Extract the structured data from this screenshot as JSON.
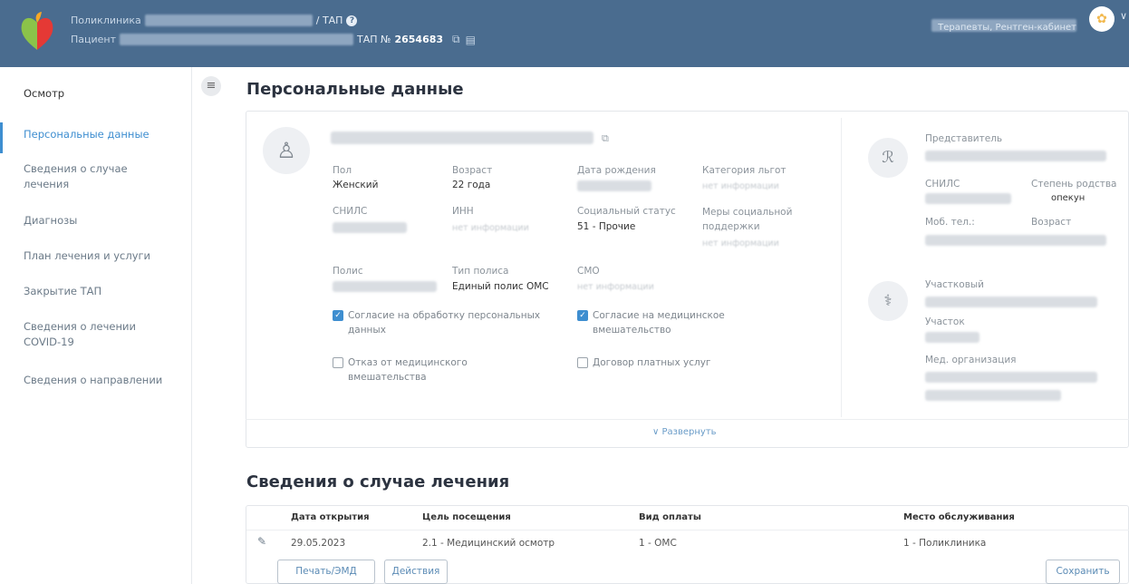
{
  "header": {
    "polyclinic_label": "Поликлиника",
    "patient_label": "Пациент",
    "tal_label": "ТАП",
    "tal_number_label": "ТАП №",
    "tal_number": "2654683",
    "help_icon": "?",
    "role_text": "Терапевты, Рентген-кабинет"
  },
  "sidebar": {
    "items": [
      {
        "label": "Осмотр"
      },
      {
        "label": "Персональные данные"
      },
      {
        "label": "Сведения о случае лечения"
      },
      {
        "label": "Диагнозы"
      },
      {
        "label": "План лечения и услуги"
      },
      {
        "label": "Закрытие ТАП"
      },
      {
        "label": "Сведения о лечении COVID-19"
      },
      {
        "label": "Сведения о направлении"
      }
    ]
  },
  "personal": {
    "title": "Персональные данные",
    "sex_label": "Пол",
    "sex_value": "Женский",
    "age_label": "Возраст",
    "age_value": "22 года",
    "birth_label": "Дата рождения",
    "benefit_label": "Категория льгот",
    "benefit_value": "нет информации",
    "snils_label": "СНИЛС",
    "inn_label": "ИНН",
    "inn_value": "нет информации",
    "social_label": "Социальный статус",
    "social_value": "51 - Прочие",
    "support_label": "Меры социальной поддержки",
    "support_value": "нет информации",
    "policy_label": "Полис",
    "policy_type_label": "Тип полиса",
    "policy_type_value": "Единый полис ОМС",
    "smo_label": "СМО",
    "smo_value": "нет информации",
    "consent_personal": "Согласие на обработку персональных данных",
    "consent_medical": "Согласие на медицинское вмешательство",
    "refusal_medical": "Отказ от медицинского вмешательства",
    "paid_contract": "Договор платных услуг",
    "expand_label": "Развернуть"
  },
  "representative": {
    "title": "Представитель",
    "snils_label": "СНИЛС",
    "relation_label": "Степень родства",
    "relation_value": "опекун",
    "phone_label": "Моб. тел.:",
    "age_label": "Возраст"
  },
  "doctor": {
    "title": "Участковый",
    "district_label": "Участок",
    "org_label": "Мед. организация"
  },
  "case": {
    "title": "Сведения о случае лечения",
    "columns": [
      "Дата открытия",
      "Цель посещения",
      "Вид оплаты",
      "Место обслуживания"
    ],
    "rows": [
      [
        "29.05.2023",
        "2.1 - Медицинский осмотр",
        "1 - ОМС",
        "1 - Поликлиника"
      ]
    ]
  },
  "buttons": {
    "print": "Печать/ЭМД",
    "actions": "Действия",
    "save": "Сохранить"
  }
}
